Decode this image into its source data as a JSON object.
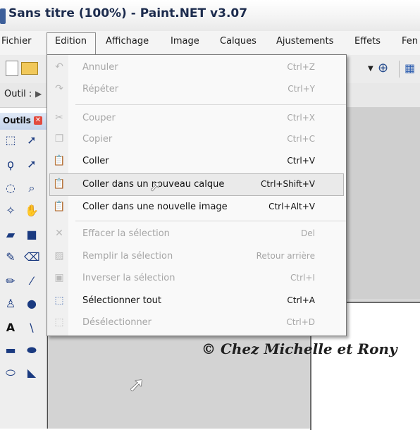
{
  "window": {
    "title": "Sans titre (100%) - Paint.NET v3.07"
  },
  "menubar": {
    "items": [
      {
        "label": "Fichier"
      },
      {
        "label": "Edition"
      },
      {
        "label": "Affichage"
      },
      {
        "label": "Image"
      },
      {
        "label": "Calques"
      },
      {
        "label": "Ajustements"
      },
      {
        "label": "Effets"
      },
      {
        "label": "Fen"
      }
    ]
  },
  "toolbar": {
    "tool_label": "Outil :"
  },
  "tools_panel": {
    "title": "Outils"
  },
  "edit_menu": {
    "items": [
      {
        "label": "Annuler",
        "shortcut": "Ctrl+Z",
        "enabled": false,
        "icon": "undo-icon"
      },
      {
        "label": "Répéter",
        "shortcut": "Ctrl+Y",
        "enabled": false,
        "icon": "redo-icon"
      },
      {
        "label": "Couper",
        "shortcut": "Ctrl+X",
        "enabled": false,
        "icon": "scissors-icon"
      },
      {
        "label": "Copier",
        "shortcut": "Ctrl+C",
        "enabled": false,
        "icon": "copy-icon"
      },
      {
        "label": "Coller",
        "shortcut": "Ctrl+V",
        "enabled": true,
        "icon": "paste-icon"
      },
      {
        "label": "Coller dans un nouveau calque",
        "shortcut": "Ctrl+Shift+V",
        "enabled": true,
        "highlighted": true,
        "icon": "paste-layer-icon"
      },
      {
        "label": "Coller dans une nouvelle image",
        "shortcut": "Ctrl+Alt+V",
        "enabled": true,
        "icon": "paste-image-icon"
      },
      {
        "label": "Effacer la sélection",
        "shortcut": "Del",
        "enabled": false,
        "icon": "erase-x-icon"
      },
      {
        "label": "Remplir la sélection",
        "shortcut": "Retour arrière",
        "enabled": false,
        "icon": "fill-icon"
      },
      {
        "label": "Inverser la sélection",
        "shortcut": "Ctrl+I",
        "enabled": false,
        "icon": "invert-selection-icon"
      },
      {
        "label": "Sélectionner tout",
        "shortcut": "Ctrl+A",
        "enabled": true,
        "icon": "select-all-icon"
      },
      {
        "label": "Désélectionner",
        "shortcut": "Ctrl+D",
        "enabled": false,
        "icon": "deselect-icon"
      }
    ]
  },
  "canvas": {
    "watermark": "© Chez Michelle et Rony"
  },
  "colors": {
    "disabled_text": "#a6a6a6",
    "enabled_text": "#111111",
    "highlight": "#eaeaea"
  }
}
